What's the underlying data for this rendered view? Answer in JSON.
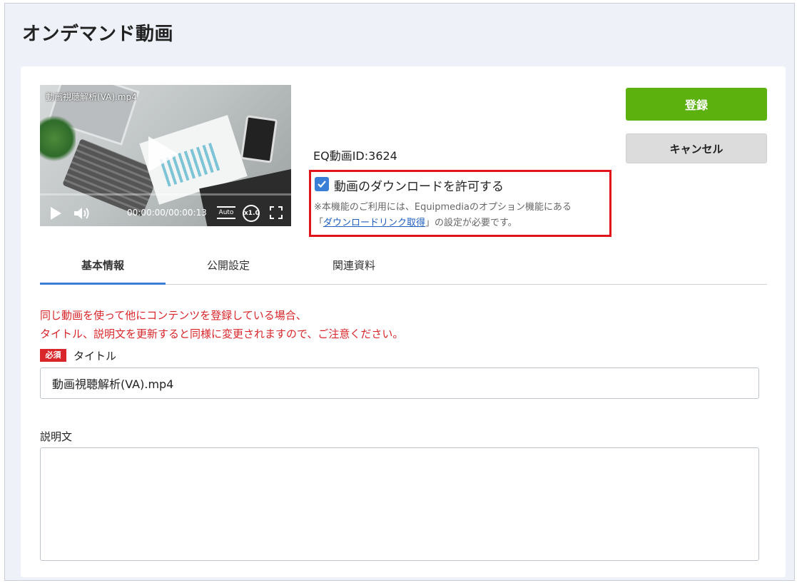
{
  "page": {
    "title": "オンデマンド動画"
  },
  "video": {
    "file_name": "動画視聴解析(VA).mp4",
    "progress_percent": 0,
    "time_display": "00:00:00/00:00:13",
    "quality_label": "Auto",
    "speed_label": "x1.0",
    "icons": [
      "play-icon",
      "volume-icon",
      "quality-icon",
      "speed-icon",
      "fullscreen-icon"
    ]
  },
  "eq_video_id": "EQ動画ID:3624",
  "download": {
    "checked": true,
    "label": "動画のダウンロードを許可する",
    "note_line1": "※本機能のご利用には、Equipmediaのオプション機能にある",
    "note_prefix": "「",
    "note_link": "ダウンロードリンク取得",
    "note_suffix": "」の設定が必要です。",
    "highlight_color": "#e0141a"
  },
  "buttons": {
    "register": "登録",
    "cancel": "キャンセル"
  },
  "colors": {
    "register_bg": "#5cb10f",
    "accent": "#3a7fd5",
    "warning": "#d9262b"
  },
  "tabs": [
    {
      "label": "基本情報",
      "active": true
    },
    {
      "label": "公開設定",
      "active": false
    },
    {
      "label": "関連資料",
      "active": false
    }
  ],
  "warning": {
    "line1": "同じ動画を使って他にコンテンツを登録している場合、",
    "line2": "タイトル、説明文を更新すると同様に変更されますので、ご注意ください。"
  },
  "form": {
    "required_badge": "必須",
    "title_label": "タイトル",
    "title_value": "動画視聴解析(VA).mp4",
    "description_label": "説明文",
    "description_value": ""
  }
}
